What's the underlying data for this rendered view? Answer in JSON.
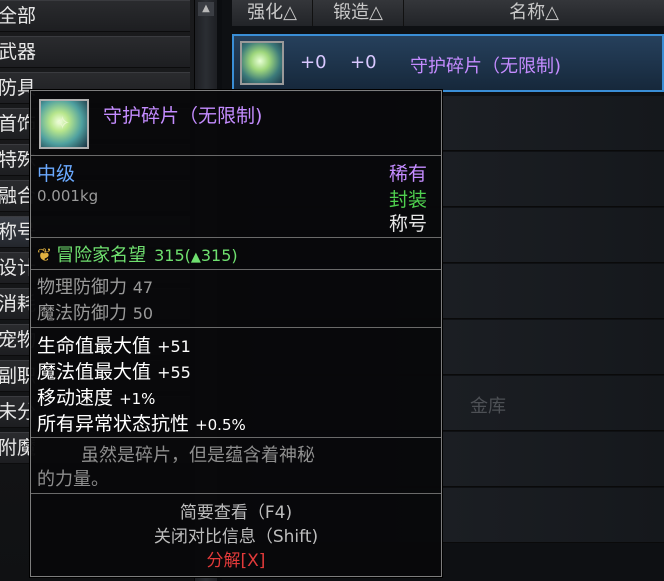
{
  "categories": [
    "全部",
    "武器",
    "防具",
    "首饰",
    "特殊装备",
    "融合",
    "称号",
    "设计图",
    "消耗品",
    "宠物",
    "副职业",
    "未分类",
    "附魔"
  ],
  "category_visible": [
    "全部",
    "武器",
    "防具",
    "首饰",
    "特殊",
    "融合",
    "称号",
    "设计",
    "消耗",
    "宠物",
    "副职",
    "未分",
    "附魔"
  ],
  "table": {
    "headers": [
      "强化△",
      "锻造△",
      "名称△"
    ],
    "selected_row": {
      "enhance": "+0",
      "forge": "+0",
      "name": "守护碎片（无限制)"
    }
  },
  "background_text": "金库",
  "tooltip": {
    "name": "守护碎片（无限制)",
    "grade": "中级",
    "weight": "0.001kg",
    "rarity": "稀有",
    "sealed": "封装",
    "type": "称号",
    "fame_label": "冒险家名望",
    "fame_value": "315(",
    "fame_up": "315)",
    "fame_arrow": "▲",
    "defense": [
      {
        "label": "物理防御力",
        "value": "47"
      },
      {
        "label": "魔法防御力",
        "value": "50"
      }
    ],
    "stats": [
      {
        "label": "生命值最大值",
        "value": "+51"
      },
      {
        "label": "魔法值最大值",
        "value": "+55"
      },
      {
        "label": "移动速度",
        "value": "+1%"
      },
      {
        "label": "所有异常状态抗性",
        "value": "+0.5%"
      }
    ],
    "desc_line1": "虽然是碎片，但是蕴含着神秘",
    "desc_line2": "的力量。",
    "hint_brief": "简要查看（F4)",
    "hint_compare": "关闭对比信息（Shift)",
    "hint_disassemble": "分解[X]"
  },
  "colors": {
    "name": "#c48cff",
    "grade": "#6aa9ff",
    "rarity": "#c48cff",
    "sealed": "#4fd04f",
    "fame": "#6fe06f",
    "stat": "#ffffff",
    "disassemble": "#e23a3a"
  },
  "icons": [
    "crest-icon",
    "item-icon",
    "scroll-up-icon"
  ]
}
